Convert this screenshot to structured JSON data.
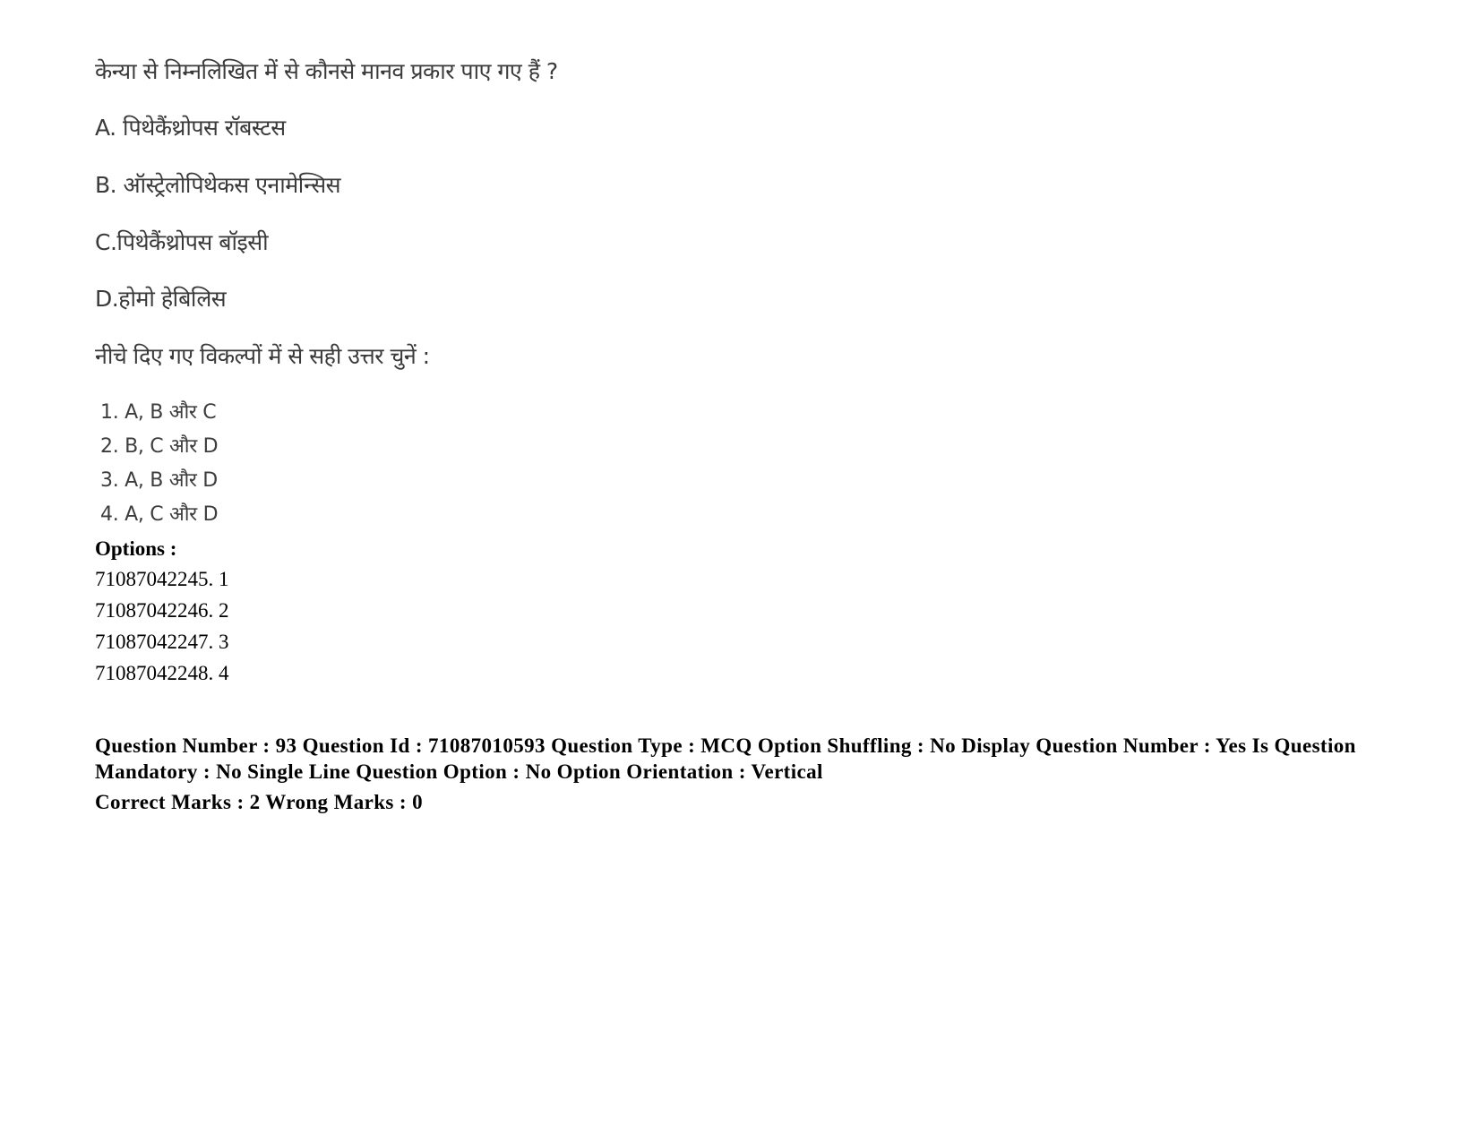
{
  "question": {
    "stem": "केन्या से निम्नलिखित में से कौनसे मानव  प्रकार पाए गए हैं ?",
    "statements": [
      {
        "label": "A.",
        "text": " पिथेकैंथ्रोपस रॉबस्टस"
      },
      {
        "label": "B.",
        "text": " ऑस्ट्रेलोपिथेकस एनामेन्सिस"
      },
      {
        "label": "C.",
        "text": "पिथेकैंथ्रोपस बॉइसी"
      },
      {
        "label": "D.",
        "text": "होमो हेबिलिस"
      }
    ],
    "instruction": "नीचे दिए गए विकल्पों में से सही उत्तर चुनें :",
    "choices": [
      "1. A, B और C",
      "2. B, C और D",
      "3. A, B और D",
      "4. A, C और D"
    ]
  },
  "options": {
    "heading": "Options :",
    "items": [
      "71087042245. 1",
      "71087042246. 2",
      "71087042247. 3",
      "71087042248. 4"
    ]
  },
  "metadata": {
    "details": "Question Number : 93 Question Id : 71087010593 Question Type : MCQ Option Shuffling : No Display Question Number : Yes Is Question Mandatory : No Single Line Question Option : No Option Orientation : Vertical",
    "marks": "Correct Marks : 2 Wrong Marks : 0"
  }
}
